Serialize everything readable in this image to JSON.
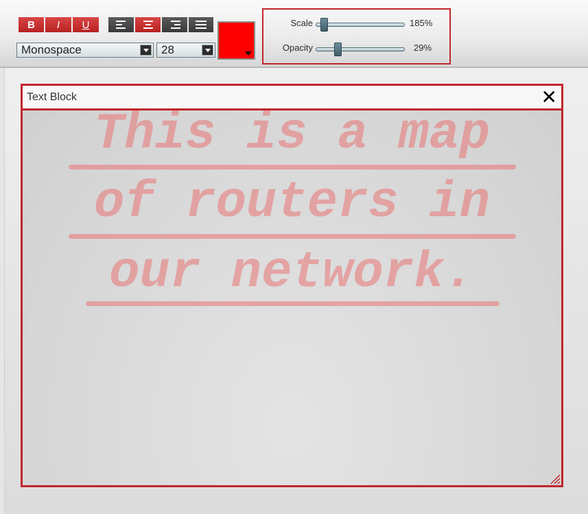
{
  "toolbar": {
    "bold_label": "B",
    "italic_label": "I",
    "underline_label": "U",
    "align_buttons": [
      "align-left",
      "align-center",
      "align-right",
      "align-justify"
    ],
    "font_family": {
      "value": "Monospace"
    },
    "font_size": {
      "value": "28"
    },
    "text_color": "#ff0000"
  },
  "sliders": {
    "scale": {
      "label": "Scale",
      "value_text": "185%",
      "fraction": 0.05
    },
    "opacity": {
      "label": "Opacity",
      "value_text": "29%",
      "fraction": 0.22
    }
  },
  "text_block": {
    "title": "Text Block",
    "close_label": "✕",
    "lines": [
      "This is a map",
      "of routers in",
      "our network."
    ]
  },
  "colors": {
    "accent_border": "#c0262a",
    "button_red": "#c83232",
    "button_dark": "#4a4a4a",
    "text_overlay": "#ec6969"
  }
}
